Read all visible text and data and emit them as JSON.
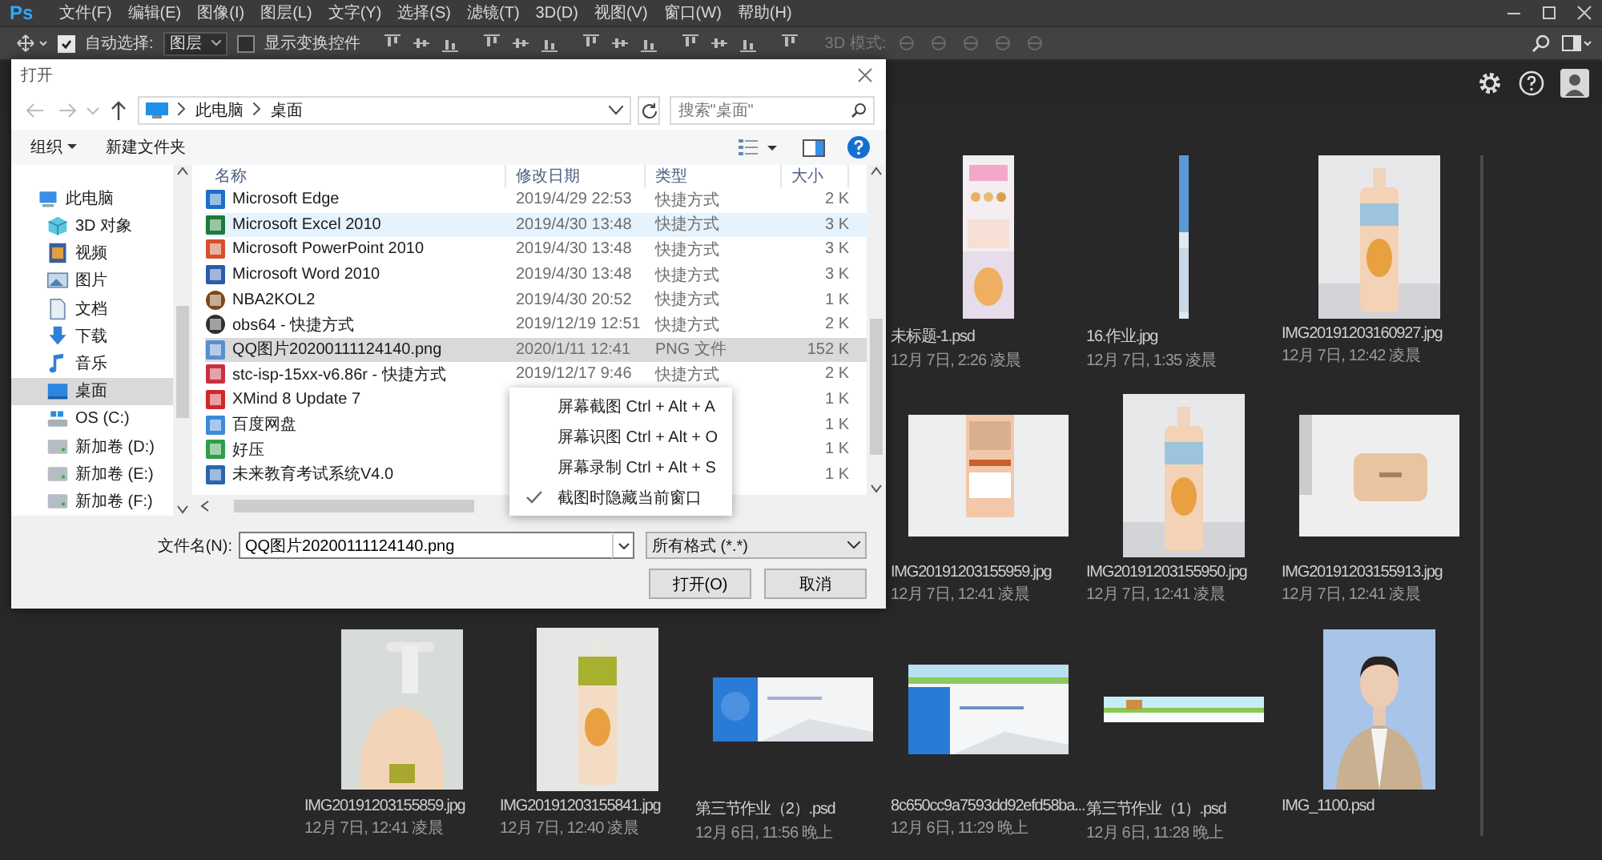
{
  "app": {
    "logo": "Ps",
    "menu": [
      "文件(F)",
      "编辑(E)",
      "图像(I)",
      "图层(L)",
      "文字(Y)",
      "选择(S)",
      "滤镜(T)",
      "3D(D)",
      "视图(V)",
      "窗口(W)",
      "帮助(H)"
    ]
  },
  "options_bar": {
    "auto_select": {
      "label": "自动选择:",
      "checked": true
    },
    "target": "图层",
    "show_transform": {
      "label": "显示变换控件",
      "checked": false
    },
    "mode_3d": "3D 模式:"
  },
  "recent_files": [
    [
      {
        "name": "未标题-1.psd",
        "date": "12月 7日, 2:26 凌晨"
      },
      {
        "name": "16.作业.jpg",
        "date": "12月 7日, 1:35 凌晨"
      },
      {
        "name": "IMG20191203160927.jpg",
        "date": "12月 7日, 12:42 凌晨"
      }
    ],
    [
      {
        "name": "IMG20191203155959.jpg",
        "date": "12月 7日, 12:41 凌晨"
      },
      {
        "name": "IMG20191203155950.jpg",
        "date": "12月 7日, 12:41 凌晨"
      },
      {
        "name": "IMG20191203155913.jpg",
        "date": "12月 7日, 12:41 凌晨"
      }
    ],
    [
      {
        "name": "IMG20191203155859.jpg",
        "date": "12月 7日, 12:41 凌晨"
      },
      {
        "name": "IMG20191203155841.jpg",
        "date": "12月 7日, 12:40 凌晨"
      },
      {
        "name": "第三节作业（2）.psd",
        "date": "12月 6日, 11:56 晚上"
      },
      {
        "name": "8c650cc9a7593dd92efd58ba...",
        "date": "12月 6日, 11:29 晚上"
      },
      {
        "name": "第三节作业（1）.psd",
        "date": "12月 6日, 11:28 晚上"
      },
      {
        "name": "IMG_1100.psd"
      }
    ]
  ],
  "dialog": {
    "title": "打开",
    "path": [
      "此电脑",
      "桌面"
    ],
    "search": {
      "placeholder": "搜索\"桌面\""
    },
    "toolbar": {
      "organize": "组织",
      "new_folder": "新建文件夹"
    },
    "nav": [
      {
        "label": "此电脑",
        "selected": false,
        "kind": "pc",
        "children": [
          {
            "label": "3D 对象",
            "selected": false,
            "kind": "cube"
          },
          {
            "label": "视频",
            "selected": false,
            "kind": "video"
          },
          {
            "label": "图片",
            "selected": false
          },
          {
            "label": "文档",
            "selected": false,
            "kind": "doc"
          },
          {
            "label": "下载",
            "selected": false,
            "kind": "download"
          },
          {
            "label": "音乐",
            "selected": false,
            "kind": "music"
          },
          {
            "label": "桌面",
            "selected": true,
            "kind": "desktop"
          },
          {
            "label": "OS (C:)",
            "selected": false,
            "kind": "os"
          },
          {
            "label": "新加卷 (D:)",
            "selected": false,
            "kind": "drive"
          },
          {
            "label": "新加卷 (E:)",
            "selected": false,
            "kind": "drive"
          },
          {
            "label": "新加卷 (F:)",
            "selected": false,
            "kind": "drive"
          }
        ]
      }
    ],
    "columns": [
      "名称",
      "修改日期",
      "类型",
      "大小"
    ],
    "files": [
      {
        "name": "Microsoft Edge",
        "date": "2019/4/29 22:53",
        "type": "快捷方式",
        "size": "2 K",
        "selected": false,
        "hovered": false
      },
      {
        "name": "Microsoft Excel 2010",
        "date": "2019/4/30 13:48",
        "type": "快捷方式",
        "size": "3 K",
        "selected": false,
        "hovered": true
      },
      {
        "name": "Microsoft PowerPoint 2010",
        "date": "2019/4/30 13:48",
        "type": "快捷方式",
        "size": "3 K",
        "selected": false,
        "hovered": false
      },
      {
        "name": "Microsoft Word 2010",
        "date": "2019/4/30 13:48",
        "type": "快捷方式",
        "size": "3 K",
        "selected": false,
        "hovered": false
      },
      {
        "name": "NBA2KOL2",
        "date": "2019/4/30 20:52",
        "type": "快捷方式",
        "size": "1 K",
        "selected": false,
        "hovered": false
      },
      {
        "name": "obs64 - 快捷方式",
        "date": "2019/12/19 12:51",
        "type": "快捷方式",
        "size": "2 K",
        "selected": false,
        "hovered": false
      },
      {
        "name": "QQ图片20200111124140.png",
        "date": "2020/1/11 12:41",
        "type": "PNG 文件",
        "size": "152 K",
        "selected": true,
        "hovered": false
      },
      {
        "name": "stc-isp-15xx-v6.86r - 快捷方式",
        "date": "2019/12/17 9:46",
        "type": "快捷方式",
        "size": "2 K",
        "selected": false,
        "hovered": false
      },
      {
        "name": "XMind 8 Update 7",
        "size": "1 K",
        "selected": false,
        "hovered": false
      },
      {
        "name": "百度网盘",
        "size": "1 K",
        "selected": false,
        "hovered": false
      },
      {
        "name": "好压",
        "size": "1 K",
        "selected": false,
        "hovered": false
      },
      {
        "name": "未来教育考试系统V4.0",
        "size": "1 K",
        "selected": false,
        "hovered": false
      }
    ],
    "file_name": {
      "label": "文件名(N):",
      "value": "QQ图片20200111124140.png"
    },
    "file_type": "所有格式 (*.*)",
    "buttons": [
      "打开(O)",
      "取消"
    ]
  },
  "context_menu": [
    {
      "label": "屏幕截图 Ctrl + Alt + A",
      "checked": false
    },
    {
      "label": "屏幕识图 Ctrl + Alt + O",
      "checked": false
    },
    {
      "label": "屏幕录制 Ctrl + Alt + S",
      "checked": false
    },
    {
      "label": "截图时隐藏当前窗口",
      "checked": true
    }
  ]
}
